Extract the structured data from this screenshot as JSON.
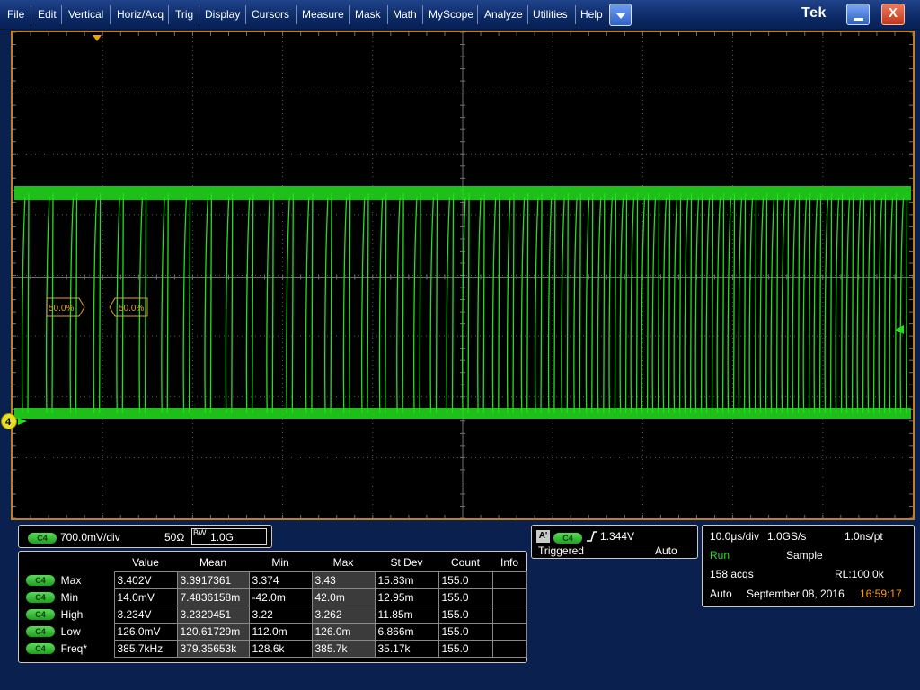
{
  "menu": {
    "items": [
      "File",
      "Edit",
      "Vertical",
      "Horiz/Acq",
      "Trig",
      "Display",
      "Cursors",
      "Measure",
      "Mask",
      "Math",
      "MyScope",
      "Analyze",
      "Utilities",
      "Help"
    ],
    "logo": "Tek",
    "close_glyph": "X"
  },
  "screen": {
    "ref_label_left": "50.0%",
    "ref_label_right": "50.0%",
    "channel_marker": "4",
    "trace_color": "#22e01c",
    "grid_color": "#5a5a5a",
    "border_color": "#c27f1c",
    "marker_color": "#f0a000"
  },
  "channel": {
    "badge": "C4",
    "scale": "700.0mV/div",
    "impedance": "50Ω",
    "bw_label": "BW",
    "bw_value": "1.0G"
  },
  "trigger": {
    "source_icon": "A'",
    "badge": "C4",
    "level": "1.344V",
    "state": "Triggered",
    "mode": "Auto"
  },
  "acquisition": {
    "timebase": "10.0μs/div",
    "sample_rate": "1.0GS/s",
    "resolution": "1.0ns/pt",
    "run_state": "Run",
    "acq_mode": "Sample",
    "acqs": "158 acqs",
    "record_length": "RL:100.0k",
    "trigger_mode": "Auto",
    "date": "September 08, 2016",
    "time": "16:59:17"
  },
  "measurements": {
    "headers": [
      "Value",
      "Mean",
      "Min",
      "Max",
      "St Dev",
      "Count",
      "Info"
    ],
    "rows": [
      {
        "badge": "C4",
        "name": "Max",
        "value": "3.402V",
        "mean": "3.3917361",
        "min": "3.374",
        "max": "3.43",
        "stdev": "15.83m",
        "count": "155.0",
        "info": ""
      },
      {
        "badge": "C4",
        "name": "Min",
        "value": "14.0mV",
        "mean": "7.4836158m",
        "min": "-42.0m",
        "max": "42.0m",
        "stdev": "12.95m",
        "count": "155.0",
        "info": ""
      },
      {
        "badge": "C4",
        "name": "High",
        "value": "3.234V",
        "mean": "3.2320451",
        "min": "3.22",
        "max": "3.262",
        "stdev": "11.85m",
        "count": "155.0",
        "info": ""
      },
      {
        "badge": "C4",
        "name": "Low",
        "value": "126.0mV",
        "mean": "120.61729m",
        "min": "112.0m",
        "max": "126.0m",
        "stdev": "6.866m",
        "count": "155.0",
        "info": ""
      },
      {
        "badge": "C4",
        "name": "Freq*",
        "value": "385.7kHz",
        "mean": "379.35653k",
        "min": "128.6k",
        "max": "385.7k",
        "stdev": "35.17k",
        "count": "155.0",
        "info": ""
      }
    ]
  }
}
